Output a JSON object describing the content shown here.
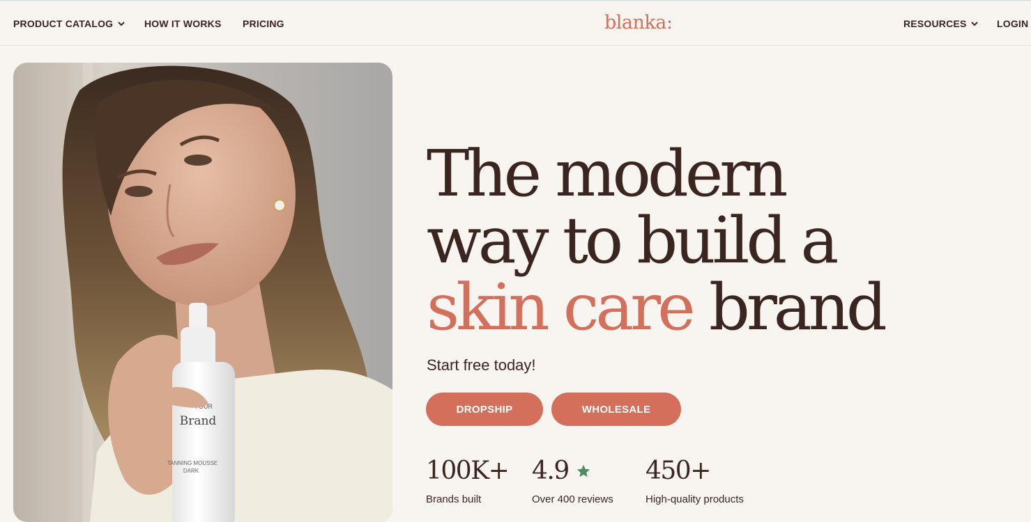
{
  "nav": {
    "left": [
      {
        "label": "PRODUCT CATALOG",
        "has_dropdown": true
      },
      {
        "label": "HOW IT WORKS",
        "has_dropdown": false
      },
      {
        "label": "PRICING",
        "has_dropdown": false
      }
    ],
    "logo": "blanka:",
    "right": [
      {
        "label": "RESOURCES",
        "has_dropdown": true
      },
      {
        "label": "LOGIN",
        "has_dropdown": false
      }
    ]
  },
  "hero": {
    "headline_line1": "The modern",
    "headline_line2": "way to build a",
    "headline_accent": "skin care",
    "headline_end": "brand",
    "subhead": "Start free today!",
    "buttons": {
      "dropship": "DROPSHIP",
      "wholesale": "WHOLESALE"
    },
    "image": {
      "bottle_label_top": "YOUR",
      "bottle_label_brand": "Brand",
      "bottle_product": "TANNING MOUSSE",
      "bottle_variant": "DARK"
    },
    "stats": [
      {
        "value": "100K+",
        "label": "Brands built"
      },
      {
        "value": "4.9",
        "label": "Over 400 reviews",
        "icon": "star-icon"
      },
      {
        "value": "450+",
        "label": "High-quality products"
      }
    ]
  },
  "colors": {
    "background": "#f8f5f0",
    "text": "#3a2520",
    "accent": "#d46f5b",
    "star": "#4e8a64"
  }
}
